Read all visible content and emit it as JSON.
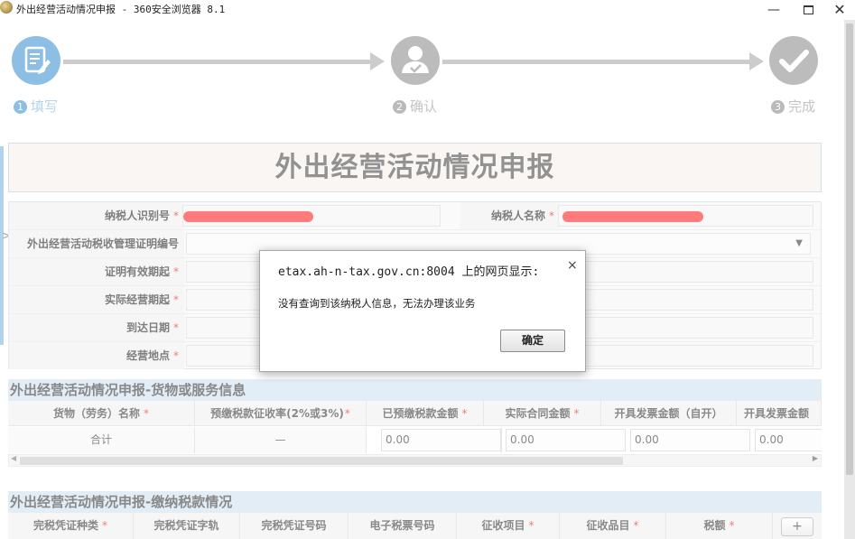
{
  "window": {
    "title": "外出经营活动情况申报 - 360安全浏览器 8.1",
    "min_glyph": "—",
    "close_glyph": "✕"
  },
  "steps": [
    {
      "num": "1",
      "label": "填写",
      "state": "active"
    },
    {
      "num": "2",
      "label": "确认",
      "state": "pending"
    },
    {
      "num": "3",
      "label": "完成",
      "state": "pending"
    }
  ],
  "page_title": "外出经营活动情况申报",
  "form": {
    "required_mark": "*",
    "taxpayer_id_label": "纳税人识别号",
    "taxpayer_name_label": "纳税人名称",
    "certificate_no_label": "外出经营活动税收管理证明编号",
    "valid_from_label": "证明有效期起",
    "actual_period_label": "实际经营期起",
    "arrival_date_label": "到达日期",
    "location_label": "经营地点",
    "select_arrow": "▼"
  },
  "goods_section": {
    "title": "外出经营活动情况申报-货物或服务信息",
    "columns": [
      "货物（劳务）名称",
      "预缴税款征收率(2%或3%)",
      "已预缴税款金额",
      "实际合同金额",
      "开具发票金额（自开）",
      "开具发票金额"
    ],
    "total_row": {
      "label": "合计",
      "rate": "—",
      "prepaid": "0.00",
      "contract": "0.00",
      "invoice_self": "0.00",
      "invoice_other": "0.00"
    }
  },
  "tax_section": {
    "title": "外出经营活动情况申报-缴纳税款情况",
    "columns": [
      "完税凭证种类",
      "完税凭证字轨",
      "完税凭证号码",
      "电子税票号码",
      "征收项目",
      "征收品目",
      "税额"
    ],
    "add_label": "+"
  },
  "dialog": {
    "title": "etax.ah-n-tax.gov.cn:8004 上的网页显示:",
    "message": "没有查询到该纳税人信息，无法办理该业务",
    "ok_label": "确定",
    "close_glyph": "×"
  },
  "colors": {
    "active_step": "#3c8fd0",
    "inactive_step": "#8c8c8c",
    "section_header_bg": "#cfe0ee",
    "required": "#e02020",
    "redaction": "#ff1a1a"
  }
}
